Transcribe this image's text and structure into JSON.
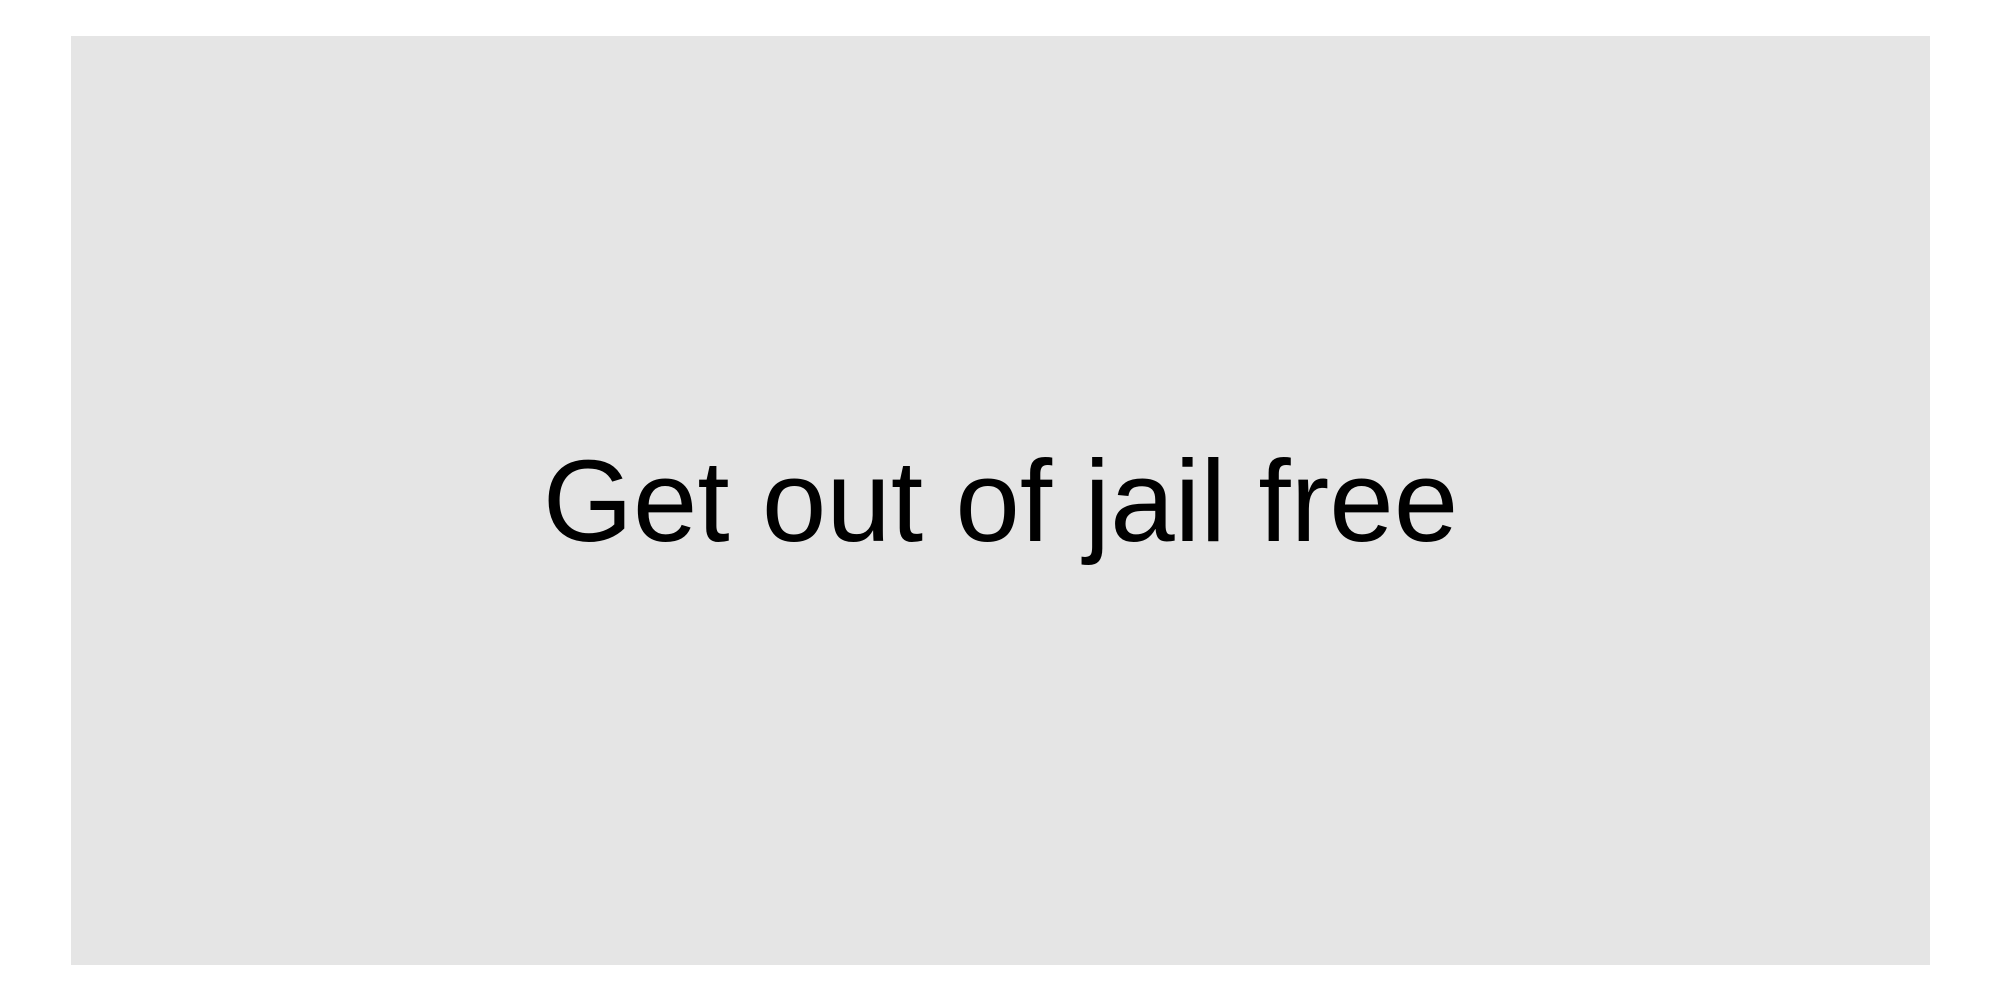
{
  "card": {
    "text": "Get out of jail free",
    "background_color": "#e5e5e5",
    "text_color": "#000000"
  }
}
